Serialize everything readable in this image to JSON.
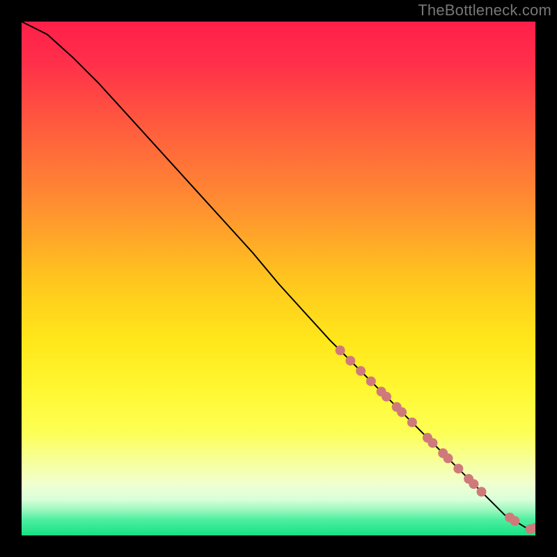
{
  "attribution": "TheBottleneck.com",
  "chart_data": {
    "type": "line",
    "title": "",
    "xlabel": "",
    "ylabel": "",
    "xlim": [
      0,
      100
    ],
    "ylim": [
      0,
      100
    ],
    "grid": false,
    "legend": false,
    "background": "red-yellow-green vertical gradient",
    "series": [
      {
        "name": "curve",
        "x": [
          0,
          2,
          5,
          10,
          15,
          20,
          25,
          30,
          35,
          40,
          45,
          50,
          55,
          60,
          62,
          65,
          70,
          72,
          75,
          78,
          80,
          82,
          84,
          86,
          88,
          90,
          92,
          94,
          96,
          98,
          99,
          100
        ],
        "y": [
          100,
          99,
          97.5,
          93,
          88,
          82.5,
          77,
          71.5,
          66,
          60.5,
          55,
          49,
          43.5,
          38,
          36,
          33,
          28,
          26,
          23,
          20,
          18,
          16,
          14,
          12,
          10,
          8,
          6,
          4,
          2.8,
          1.6,
          1.2,
          1.5
        ]
      }
    ],
    "markers": {
      "name": "highlighted-points",
      "color": "#cf7a7a",
      "radius_screen_px": 7,
      "points": [
        {
          "x": 62,
          "y": 36
        },
        {
          "x": 64,
          "y": 34
        },
        {
          "x": 66,
          "y": 32
        },
        {
          "x": 68,
          "y": 30
        },
        {
          "x": 70,
          "y": 28
        },
        {
          "x": 71,
          "y": 27
        },
        {
          "x": 73,
          "y": 25
        },
        {
          "x": 74,
          "y": 24
        },
        {
          "x": 76,
          "y": 22
        },
        {
          "x": 79,
          "y": 19
        },
        {
          "x": 80,
          "y": 18
        },
        {
          "x": 82,
          "y": 16
        },
        {
          "x": 83,
          "y": 15
        },
        {
          "x": 85,
          "y": 13
        },
        {
          "x": 87,
          "y": 11
        },
        {
          "x": 88,
          "y": 10
        },
        {
          "x": 89.5,
          "y": 8.5
        },
        {
          "x": 95,
          "y": 3.5
        },
        {
          "x": 96,
          "y": 2.8
        },
        {
          "x": 99,
          "y": 1.2
        },
        {
          "x": 100,
          "y": 1.5
        }
      ]
    }
  }
}
